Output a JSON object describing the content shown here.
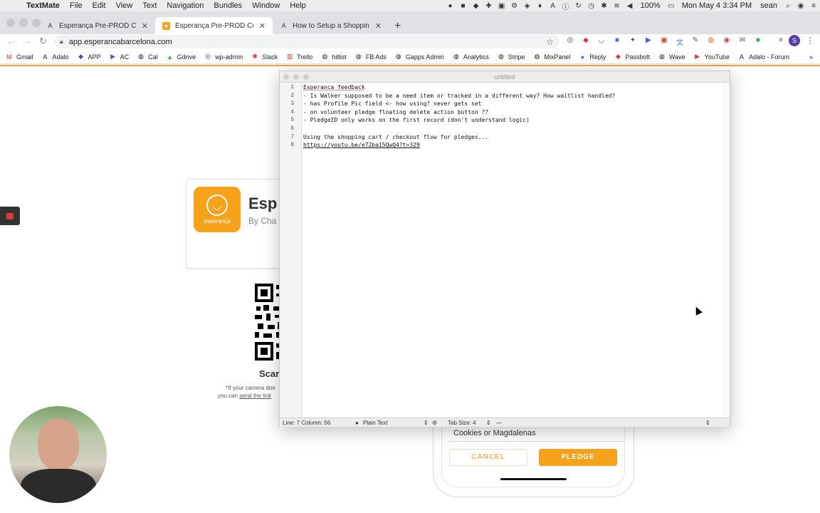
{
  "menubar": {
    "app": "TextMate",
    "items": [
      "File",
      "Edit",
      "View",
      "Text",
      "Navigation",
      "Bundles",
      "Window",
      "Help"
    ],
    "battery": "100%",
    "datetime": "Mon May 4  3:34 PM",
    "user": "sean"
  },
  "browser": {
    "tabs": [
      {
        "title": "Esperança Pre-PROD Copy"
      },
      {
        "title": "Esperança Pre-PROD Copy"
      },
      {
        "title": "How to Setup a Shopping Cart"
      }
    ],
    "url": "app.esperancabarcelona.com",
    "profile_initial": "S",
    "bookmarks": [
      "Gmail",
      "Adalo",
      "APP",
      "AC",
      "Cal",
      "Gdrive",
      "wp-admin",
      "Slack",
      "Trello",
      "hitlist",
      "FB Ads",
      "Gapps Admin",
      "Analytics",
      "Stripe",
      "MixPanel",
      "Reply",
      "Passbolt",
      "Wave",
      "YouTube",
      "Adalo - Forum"
    ]
  },
  "page": {
    "app_logo_text": "esperança",
    "app_name": "Esp",
    "app_by": "By Cha",
    "scan_title": "Scar",
    "hint_line1": "*If your camera doe",
    "hint_line2_prefix": "you can ",
    "hint_line2_link": "send the link",
    "phone": {
      "field_value": "Cookies or Magdalenas",
      "cancel_label": "CANCEL",
      "pledge_label": "PLEDGE"
    }
  },
  "textmate": {
    "window_title": "untitled",
    "line_numbers": [
      "1",
      "2",
      "3",
      "4",
      "5",
      "6",
      "7",
      "8"
    ],
    "lines": [
      "Esperanca feedback",
      "- Is Walker supposed to be a need item or tracked in a different way? How waitlist handled?",
      "- has Profile Pic field <- how using? never gets set",
      "- on volunteer pledge floating delete action button ??",
      "- PledgeID only works on the first record (don't understand logic)",
      "",
      "Using the shopping cart / checkout flow for pledges...",
      "https://youtu.be/e72ba15QwQ4?t=329"
    ],
    "status": {
      "position": "Line: 7   Column: 56",
      "grammar": "Plain Text",
      "tab_size": "Tab Size:  4",
      "symbol": "—"
    }
  },
  "colors": {
    "accent": "#f7a21b",
    "profile": "#5b3fa8"
  }
}
